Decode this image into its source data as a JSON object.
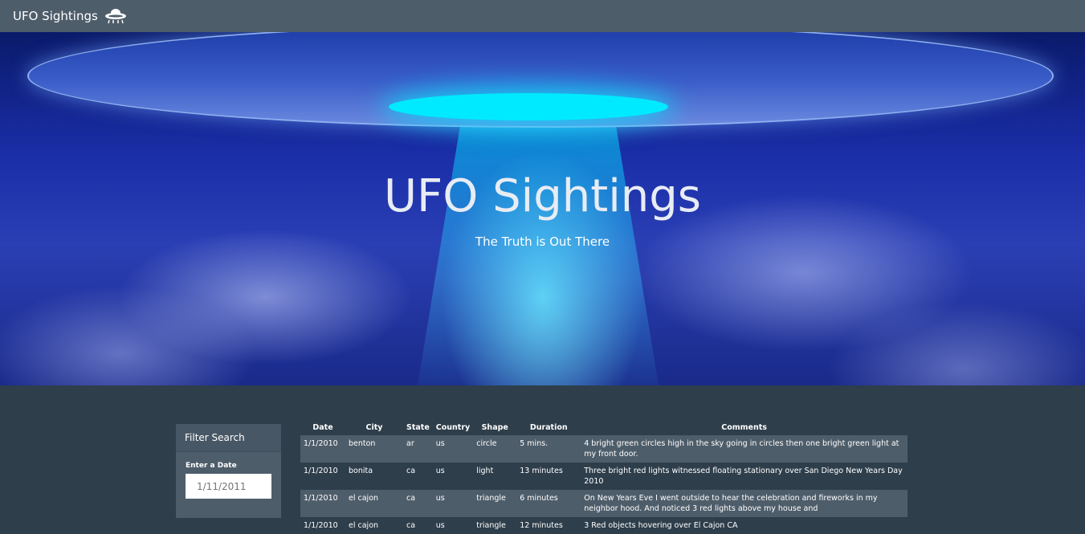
{
  "navbar": {
    "brand": "UFO Sightings",
    "brand_icon": "ufo-icon"
  },
  "hero": {
    "title": "UFO Sightings",
    "subtitle": "The Truth is Out There"
  },
  "filter": {
    "header": "Filter Search",
    "label": "Enter a Date",
    "placeholder": "1/11/2011"
  },
  "table": {
    "headers": [
      "Date",
      "City",
      "State",
      "Country",
      "Shape",
      "Duration",
      "Comments"
    ],
    "rows": [
      [
        "1/1/2010",
        "benton",
        "ar",
        "us",
        "circle",
        "5 mins.",
        "4 bright green circles high in the sky going in circles then one bright green light at my front door."
      ],
      [
        "1/1/2010",
        "bonita",
        "ca",
        "us",
        "light",
        "13 minutes",
        "Three bright red lights witnessed floating stationary over San Diego New Years Day 2010"
      ],
      [
        "1/1/2010",
        "el cajon",
        "ca",
        "us",
        "triangle",
        "6 minutes",
        "On New Years Eve I went outside to hear the celebration and fireworks in my neighbor hood. And noticed 3 red lights above my house and"
      ],
      [
        "1/1/2010",
        "el cajon",
        "ca",
        "us",
        "triangle",
        "12 minutes",
        "3 Red objects hovering over El Cajon CA"
      ]
    ]
  },
  "colors": {
    "nav": "#4e5d6a",
    "body": "#2e3e4b",
    "beam": "#00eaff"
  }
}
